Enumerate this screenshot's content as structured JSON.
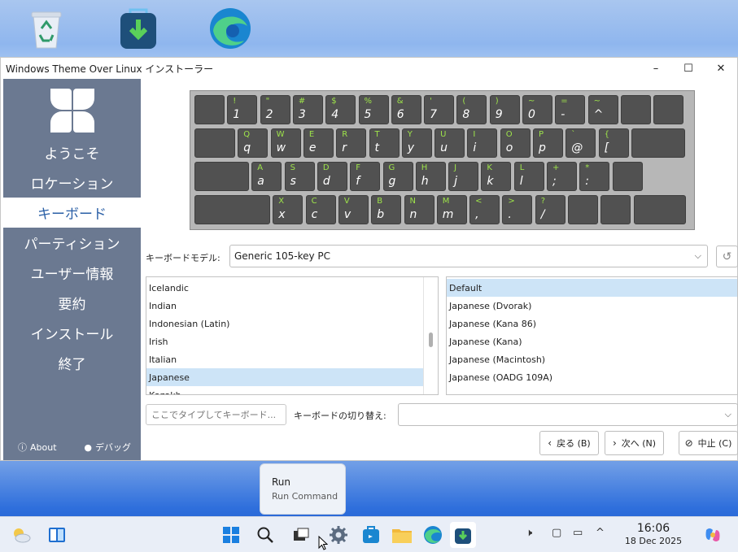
{
  "window": {
    "title": "Windows Theme Over Linux インストーラー",
    "controls": {
      "minimize": "–",
      "maximize": "☐",
      "close": "✕"
    }
  },
  "sidebar": {
    "items": [
      {
        "label": "ようこそ"
      },
      {
        "label": "ロケーション"
      },
      {
        "label": "キーボード",
        "active": true
      },
      {
        "label": "パーティション"
      },
      {
        "label": "ユーザー情報"
      },
      {
        "label": "要約"
      },
      {
        "label": "インストール"
      },
      {
        "label": "終了"
      }
    ],
    "about": "About",
    "debug": "デバッグ"
  },
  "keyboard": {
    "rows": [
      [
        {
          "s": "",
          "m": ""
        },
        {
          "s": "!",
          "m": "1"
        },
        {
          "s": "\"",
          "m": "2"
        },
        {
          "s": "#",
          "m": "3"
        },
        {
          "s": "$",
          "m": "4"
        },
        {
          "s": "%",
          "m": "5"
        },
        {
          "s": "&",
          "m": "6"
        },
        {
          "s": "'",
          "m": "7"
        },
        {
          "s": "(",
          "m": "8"
        },
        {
          "s": ")",
          "m": "9"
        },
        {
          "s": "~",
          "m": "0"
        },
        {
          "s": "=",
          "m": "-"
        },
        {
          "s": "~",
          "m": "^"
        },
        {
          "s": "",
          "m": ""
        },
        {
          "s": "",
          "m": ""
        }
      ],
      [
        {
          "s": "",
          "m": ""
        },
        {
          "s": "Q",
          "m": "q"
        },
        {
          "s": "W",
          "m": "w"
        },
        {
          "s": "E",
          "m": "e"
        },
        {
          "s": "R",
          "m": "r"
        },
        {
          "s": "T",
          "m": "t"
        },
        {
          "s": "Y",
          "m": "y"
        },
        {
          "s": "U",
          "m": "u"
        },
        {
          "s": "I",
          "m": "i"
        },
        {
          "s": "O",
          "m": "o"
        },
        {
          "s": "P",
          "m": "p"
        },
        {
          "s": "`",
          "m": "@"
        },
        {
          "s": "{",
          "m": "["
        },
        {
          "s": "",
          "m": ""
        }
      ],
      [
        {
          "s": "",
          "m": ""
        },
        {
          "s": "A",
          "m": "a"
        },
        {
          "s": "S",
          "m": "s"
        },
        {
          "s": "D",
          "m": "d"
        },
        {
          "s": "F",
          "m": "f"
        },
        {
          "s": "G",
          "m": "g"
        },
        {
          "s": "H",
          "m": "h"
        },
        {
          "s": "J",
          "m": "j"
        },
        {
          "s": "K",
          "m": "k"
        },
        {
          "s": "L",
          "m": "l"
        },
        {
          "s": "+",
          "m": ";"
        },
        {
          "s": "*",
          "m": ":"
        },
        {
          "s": "",
          "m": ""
        }
      ],
      [
        {
          "s": "",
          "m": ""
        },
        {
          "s": "X",
          "m": "x"
        },
        {
          "s": "C",
          "m": "c"
        },
        {
          "s": "V",
          "m": "v"
        },
        {
          "s": "B",
          "m": "b"
        },
        {
          "s": "N",
          "m": "n"
        },
        {
          "s": "M",
          "m": "m"
        },
        {
          "s": "<",
          "m": ","
        },
        {
          "s": ">",
          "m": "."
        },
        {
          "s": "?",
          "m": "/"
        },
        {
          "s": "",
          "m": ""
        },
        {
          "s": "",
          "m": ""
        },
        {
          "s": "",
          "m": ""
        }
      ]
    ]
  },
  "model": {
    "label": "キーボードモデル:",
    "value": "Generic 105-key PC"
  },
  "layouts": {
    "items": [
      "Icelandic",
      "Indian",
      "Indonesian (Latin)",
      "Irish",
      "Italian",
      "Japanese",
      "Kazakh"
    ],
    "selected": "Japanese"
  },
  "variants": {
    "items": [
      "Default",
      "Japanese (Dvorak)",
      "Japanese (Kana 86)",
      "Japanese (Kana)",
      "Japanese (Macintosh)",
      "Japanese (OADG 109A)"
    ],
    "selected": "Default"
  },
  "filter": {
    "placeholder": "ここでタイプしてキーボード..."
  },
  "switch": {
    "label": "キーボードの切り替え:",
    "value": ""
  },
  "buttons": {
    "back": "戻る (B)",
    "next": "次へ (N)",
    "cancel": "中止 (C)"
  },
  "tooltip": {
    "title": "Run",
    "subtitle": "Run Command"
  },
  "clock": {
    "time": "16:06",
    "date": "18 Dec 2025"
  },
  "colors": {
    "sidebar": "#6b7991",
    "accent": "#2a5fa6",
    "key": "#515151",
    "key_shift": "#9ee44a"
  }
}
